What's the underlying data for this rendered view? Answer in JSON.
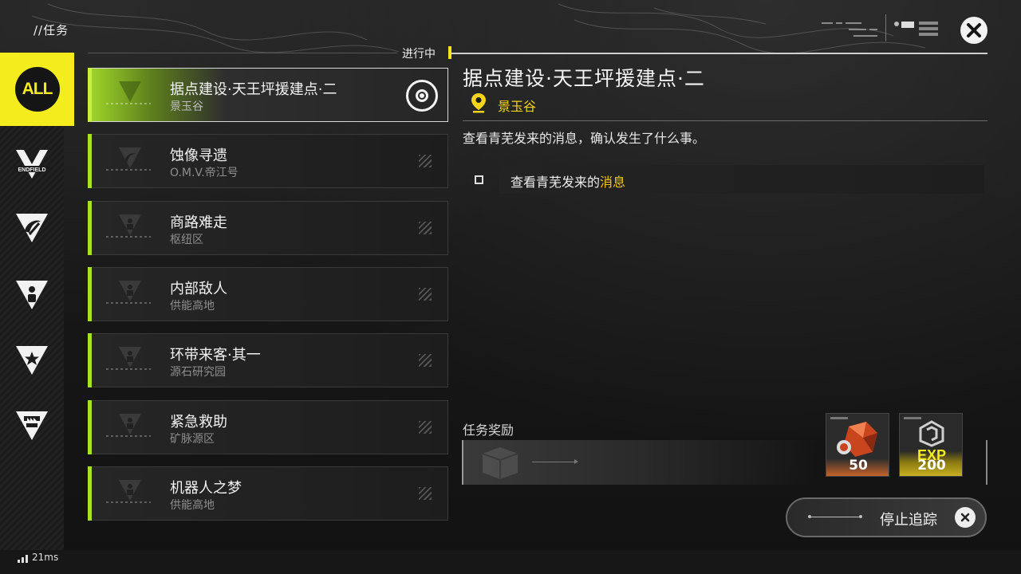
{
  "header": {
    "page_title": "//任务",
    "status_label": "进行中"
  },
  "categories": [
    {
      "id": "all",
      "label": "ALL",
      "active": true
    },
    {
      "id": "endfield",
      "icon": "endfield-logo-icon",
      "label": "ENDFIELD"
    },
    {
      "id": "side",
      "icon": "swirl-triangle-icon"
    },
    {
      "id": "character",
      "icon": "person-triangle-icon"
    },
    {
      "id": "star",
      "icon": "star-triangle-icon"
    },
    {
      "id": "facility",
      "icon": "factory-triangle-icon"
    }
  ],
  "missions": [
    {
      "title": "据点建设·天王坪援建点·二",
      "location": "景玉谷",
      "active": true
    },
    {
      "title": "蚀像寻遗",
      "location": "O.M.V.帝江号"
    },
    {
      "title": "商路难走",
      "location": "枢纽区"
    },
    {
      "title": "内部敌人",
      "location": "供能高地"
    },
    {
      "title": "环带来客·其一",
      "location": "源石研究园"
    },
    {
      "title": "紧急救助",
      "location": "矿脉源区"
    },
    {
      "title": "机器人之梦",
      "location": "供能高地"
    }
  ],
  "detail": {
    "title": "据点建设·天王坪援建点·二",
    "location": "景玉谷",
    "description": "查看青芜发来的消息，确认发生了什么事。",
    "objective_prefix": "查看青芜发来的",
    "objective_highlight": "消息"
  },
  "rewards": {
    "label": "任务奖励",
    "items": [
      {
        "name": "orange-crystal-reward",
        "quantity": "50"
      },
      {
        "name": "exp-reward",
        "badge": "EXP",
        "quantity": "200"
      }
    ]
  },
  "actions": {
    "stop_tracking": "停止追踪"
  },
  "status": {
    "ping": "21ms"
  },
  "colors": {
    "accent_yellow": "#f4ec1c",
    "accent_green": "#a6e22a",
    "highlight_gold": "#f4c81a"
  }
}
